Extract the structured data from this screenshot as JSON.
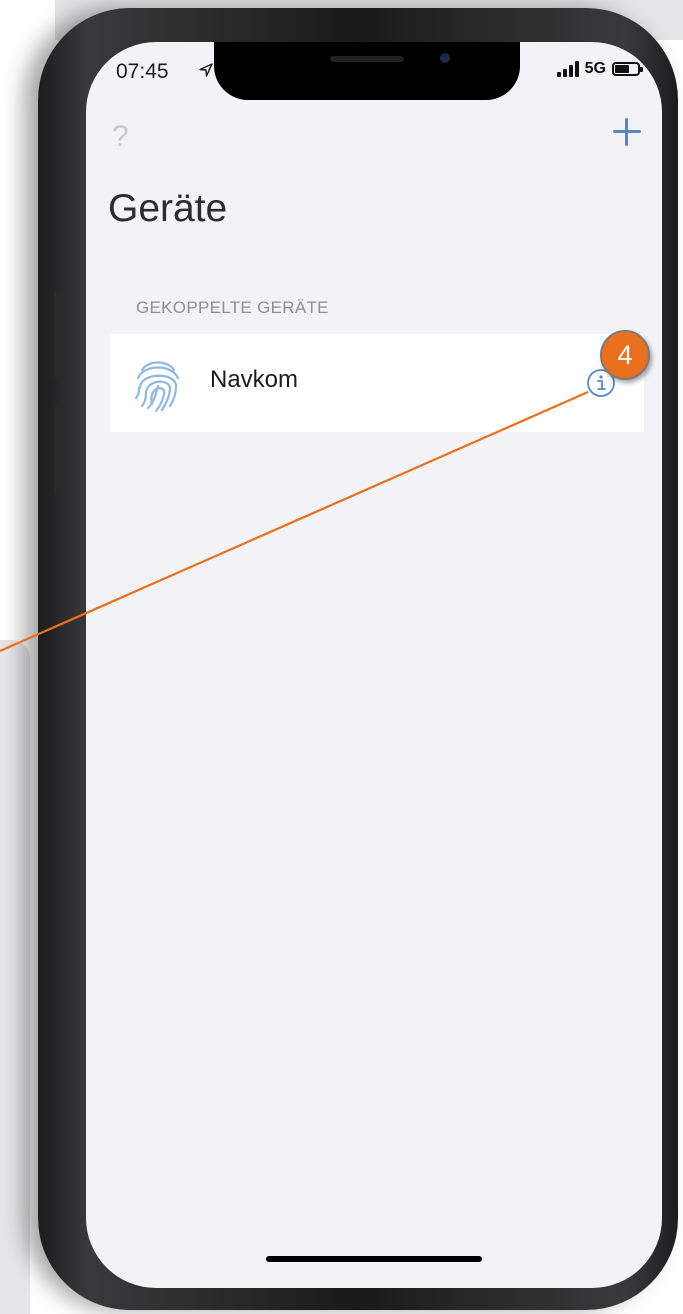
{
  "status_bar": {
    "time": "07:45",
    "network": "5G"
  },
  "nav": {
    "help_label": "?",
    "add_icon": "plus-icon"
  },
  "page": {
    "title": "Geräte"
  },
  "section": {
    "header": "GEKOPPELTE GERÄTE"
  },
  "devices": [
    {
      "name": "Navkom",
      "icon": "fingerprint-icon"
    }
  ],
  "annotation": {
    "badge": "4"
  },
  "colors": {
    "accent": "#5b86c5",
    "callout": "#e8701e",
    "background": "#f2f2f7"
  }
}
